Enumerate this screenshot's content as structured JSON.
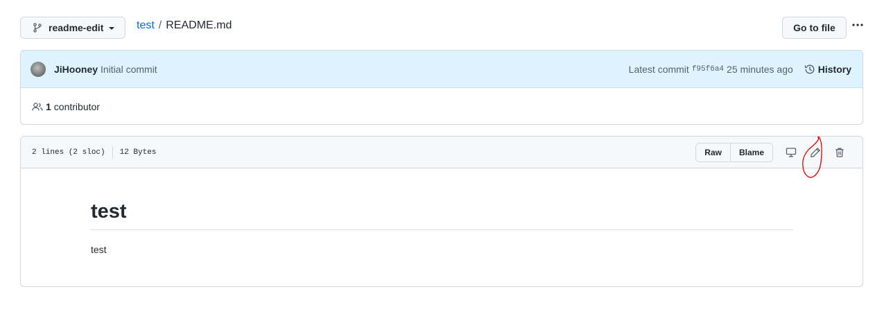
{
  "top_bar": {
    "branch": "readme-edit",
    "repo": "test",
    "separator": "/",
    "file": "README.md",
    "goto_file": "Go to file"
  },
  "commit": {
    "author": "JiHooney",
    "message": "Initial commit",
    "latest_label": "Latest commit",
    "sha": "f95f6a4",
    "time": "25 minutes ago",
    "history": "History"
  },
  "contributors": {
    "count": "1",
    "label": "contributor"
  },
  "file_header": {
    "lines": "2 lines (2 sloc)",
    "size": "12 Bytes",
    "raw": "Raw",
    "blame": "Blame"
  },
  "readme": {
    "heading": "test",
    "body": "test"
  },
  "colors": {
    "link": "#0969da",
    "annotation": "#e00000",
    "commit_bg": "#ddf4ff"
  }
}
